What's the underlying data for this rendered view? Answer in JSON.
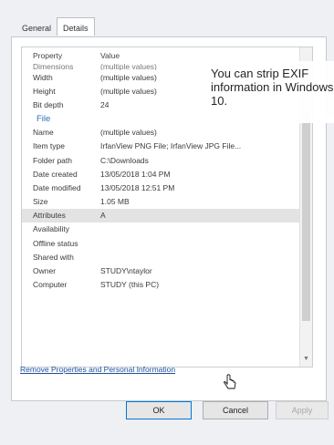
{
  "tabs": [
    {
      "label": "General"
    },
    {
      "label": "Details"
    }
  ],
  "columns": {
    "property": "Property",
    "value": "Value"
  },
  "clipped_row": {
    "key": "Dimensions",
    "value": "(multiple values)"
  },
  "rows_top": [
    {
      "key": "Width",
      "value": "(multiple values)"
    },
    {
      "key": "Height",
      "value": "(multiple values)"
    },
    {
      "key": "Bit depth",
      "value": "24"
    }
  ],
  "group_label": "File",
  "rows_file": [
    {
      "key": "Name",
      "value": "(multiple values)"
    },
    {
      "key": "Item type",
      "value": "IrfanView PNG File; IrfanView JPG File..."
    },
    {
      "key": "Folder path",
      "value": "C:\\Downloads"
    },
    {
      "key": "Date created",
      "value": "13/05/2018 1:04 PM"
    },
    {
      "key": "Date modified",
      "value": "13/05/2018 12:51 PM"
    },
    {
      "key": "Size",
      "value": "1.05 MB"
    },
    {
      "key": "Attributes",
      "value": "A"
    },
    {
      "key": "Availability",
      "value": ""
    },
    {
      "key": "Offline status",
      "value": ""
    },
    {
      "key": "Shared with",
      "value": ""
    },
    {
      "key": "Owner",
      "value": "STUDY\\ntaylor"
    },
    {
      "key": "Computer",
      "value": "STUDY (this PC)"
    }
  ],
  "remove_link": "Remove Properties and Personal Information",
  "buttons": {
    "ok": "OK",
    "cancel": "Cancel",
    "apply": "Apply"
  },
  "callout": "You can strip EXIF information in Windows 10.",
  "icons": [
    "scroll-down-arrow-icon",
    "hand-cursor-icon"
  ]
}
